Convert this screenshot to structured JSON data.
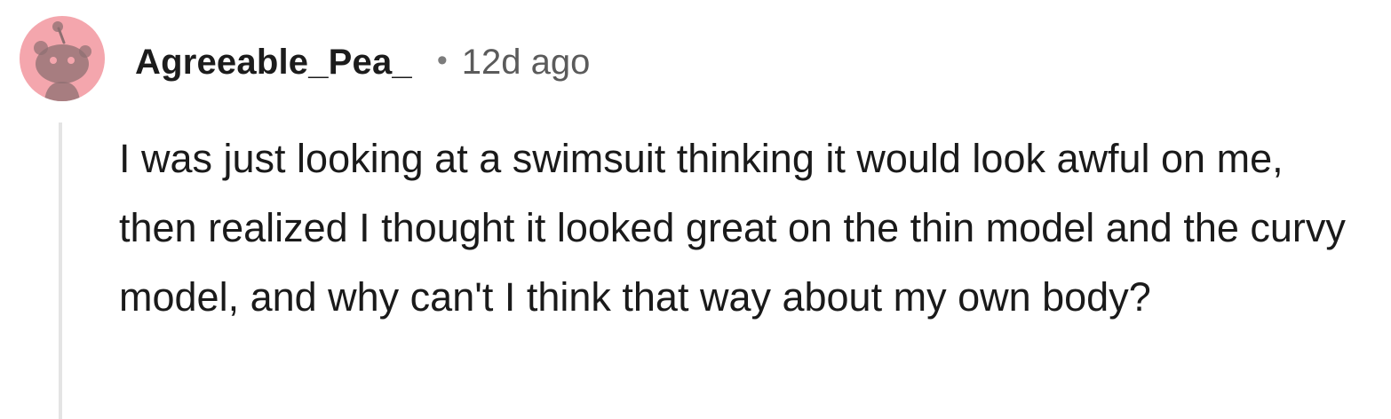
{
  "comment": {
    "author": "Agreeable_Pea_",
    "separator": "•",
    "time_ago": "12d ago",
    "body": "I was just looking at a swimsuit thinking it would look awful on me, then realized I thought it looked great on the thin model and the curvy model, and why can't I think that way about my own body?",
    "avatar_icon": "reddit-snoo-avatar-icon",
    "colors": {
      "avatar_bg": "#f4a6ad",
      "avatar_figure": "#ffffff",
      "thread_line": "#e4e4e4",
      "meta_text": "#5b5b5b"
    }
  }
}
